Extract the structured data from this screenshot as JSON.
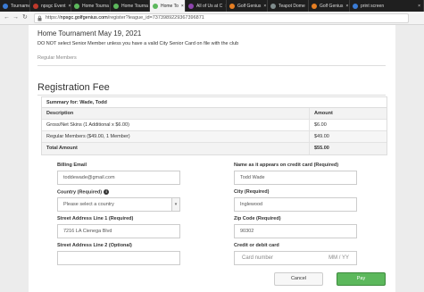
{
  "tabs": [
    {
      "label": "Tournamer",
      "fav": "#3a7bd5"
    },
    {
      "label": "npsgc Event",
      "fav": "#c0392b"
    },
    {
      "label": "Home Tourna",
      "fav": "#5cb85c"
    },
    {
      "label": "Home Tourna",
      "fav": "#5cb85c"
    },
    {
      "label": "Home To",
      "fav": "#5cb85c",
      "active": true
    },
    {
      "label": "All of Us at C",
      "fav": "#8e44ad"
    },
    {
      "label": "Golf Genius",
      "fav": "#e67e22"
    },
    {
      "label": "Teapot Dome",
      "fav": "#7f8c8d"
    },
    {
      "label": "Golf Genius",
      "fav": "#e67e22"
    },
    {
      "label": "print screen",
      "fav": "#3a7bd5"
    }
  ],
  "url": {
    "prefix": "https://",
    "host": "npsgc.golfgenius.com",
    "path": "/register?league_id=7373989229367396871"
  },
  "page": {
    "title": "Home Tournament May 19, 2021",
    "note": "DO NOT select Senior Member unless you have a valid City Senior Card on file with the club",
    "section_label": "Regular Members",
    "reg_title": "Registration Fee"
  },
  "summary": {
    "heading": "Summary for: Wade, Todd",
    "col_description": "Description",
    "col_amount": "Amount",
    "rows": [
      {
        "desc": "Gross/Net Skins (1 Additional x $6.00)",
        "amount": "$6.00"
      },
      {
        "desc": "Regular Members ($49.00, 1 Member)",
        "amount": "$49.00"
      }
    ],
    "total_label": "Total Amount",
    "total_amount": "$55.00"
  },
  "form": {
    "billing_email_label": "Billing Email",
    "billing_email_value": "toddewade@gmail.com",
    "name_label": "Name as it appears on credit card (Required)",
    "name_value": "Todd Wade",
    "country_label": "Country (Required)",
    "country_value": "Please select a country",
    "city_label": "City (Required)",
    "city_value": "Inglewood",
    "street1_label": "Street Address Line 1 (Required)",
    "street1_value": "7216 LA Cienega Blvd",
    "zip_label": "Zip Code (Required)",
    "zip_value": "90302",
    "street2_label": "Street Address Line 2 (Optional)",
    "street2_value": "",
    "card_label": "Credit or debit card",
    "card_number_placeholder": "Card number",
    "card_expiry_placeholder": "MM / YY"
  },
  "buttons": {
    "cancel": "Cancel",
    "pay": "Pay"
  },
  "colors": {
    "pay_button": "#5cb85c",
    "tab_strip": "#1f1f1f"
  }
}
